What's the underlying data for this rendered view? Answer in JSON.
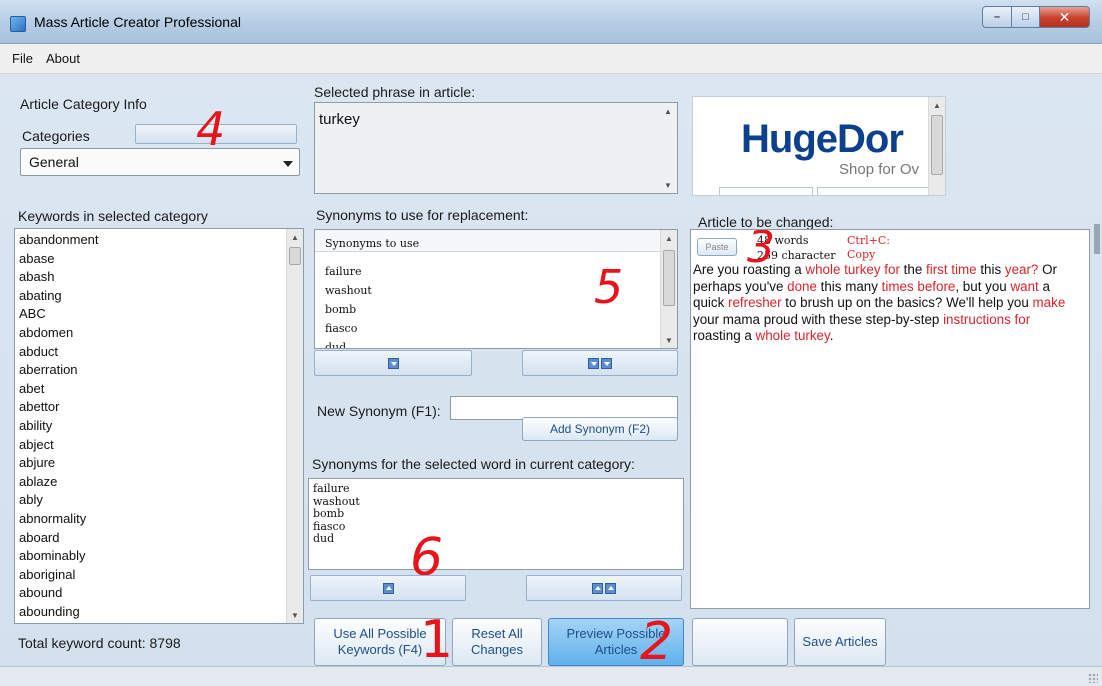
{
  "window": {
    "title": "Mass Article Creator Professional",
    "controls": {
      "minimize": "–",
      "maximize": "□",
      "close": "✕"
    }
  },
  "menu": [
    "File",
    "About"
  ],
  "category_info": {
    "group_label": "Article Category Info",
    "categories_label": "Categories",
    "selected": "General"
  },
  "keywords": {
    "label": "Keywords in selected category",
    "items": [
      "abandonment",
      "abase",
      "abash",
      "abating",
      "ABC",
      "abdomen",
      "abduct",
      "aberration",
      "abet",
      "abettor",
      "ability",
      "abject",
      "abjure",
      "ablaze",
      "ably",
      "abnormality",
      "aboard",
      "abominably",
      "aboriginal",
      "abound",
      "abounding",
      "about"
    ],
    "total_label": "Total keyword count: 8798"
  },
  "selected_phrase": {
    "label": "Selected phrase in article:",
    "value": "turkey"
  },
  "synonyms_replace": {
    "label": "Synonyms to use for replacement:",
    "header": "Synonyms to use",
    "items": [
      "failure",
      "washout",
      "bomb",
      "fiasco",
      "dud"
    ]
  },
  "new_synonym": {
    "label": "New Synonym (F1):",
    "value": "",
    "add_button": "Add Synonym (F2)"
  },
  "synonyms_current": {
    "label": "Synonyms for the selected word in current category:",
    "items": [
      "failure",
      "washout",
      "bomb",
      "fiasco",
      "dud"
    ]
  },
  "ad": {
    "brand": "HugeDor",
    "tagline": "Shop for Ov"
  },
  "article": {
    "label": "Article to be changed:",
    "paste_button": "Paste",
    "word_count": "48 words",
    "char_count": "259 character",
    "copy_hint": "Ctrl+C:",
    "copy_button": "Copy",
    "segments": [
      {
        "t": "Are you roasting a ",
        "hl": false
      },
      {
        "t": "whole turkey for",
        "hl": true
      },
      {
        "t": " the ",
        "hl": false
      },
      {
        "t": "first time",
        "hl": true
      },
      {
        "t": " this ",
        "hl": false
      },
      {
        "t": "year?",
        "hl": true
      },
      {
        "t": " Or perhaps you've ",
        "hl": false
      },
      {
        "t": "done",
        "hl": true
      },
      {
        "t": " this many ",
        "hl": false
      },
      {
        "t": "times before",
        "hl": true
      },
      {
        "t": ", but you ",
        "hl": false
      },
      {
        "t": "want",
        "hl": true
      },
      {
        "t": " a quick ",
        "hl": false
      },
      {
        "t": "refresher",
        "hl": true
      },
      {
        "t": " to brush up on the basics? We'll help you ",
        "hl": false
      },
      {
        "t": "make",
        "hl": true
      },
      {
        "t": " your mama proud with these step-by-step ",
        "hl": false
      },
      {
        "t": "instructions for",
        "hl": true
      },
      {
        "t": " roasting a ",
        "hl": false
      },
      {
        "t": "whole turkey",
        "hl": true
      },
      {
        "t": ".",
        "hl": false
      }
    ]
  },
  "buttons": {
    "use_all": "Use All Possible Keywords (F4)",
    "reset": "Reset All Changes",
    "preview": "Preview Possible Articles",
    "blank": "",
    "save": "Save Articles"
  },
  "annotations": [
    "4",
    "5",
    "3",
    "6",
    "1",
    "2"
  ],
  "colors": {
    "highlight": "#d9262a",
    "accent": "#5fb2ec"
  }
}
